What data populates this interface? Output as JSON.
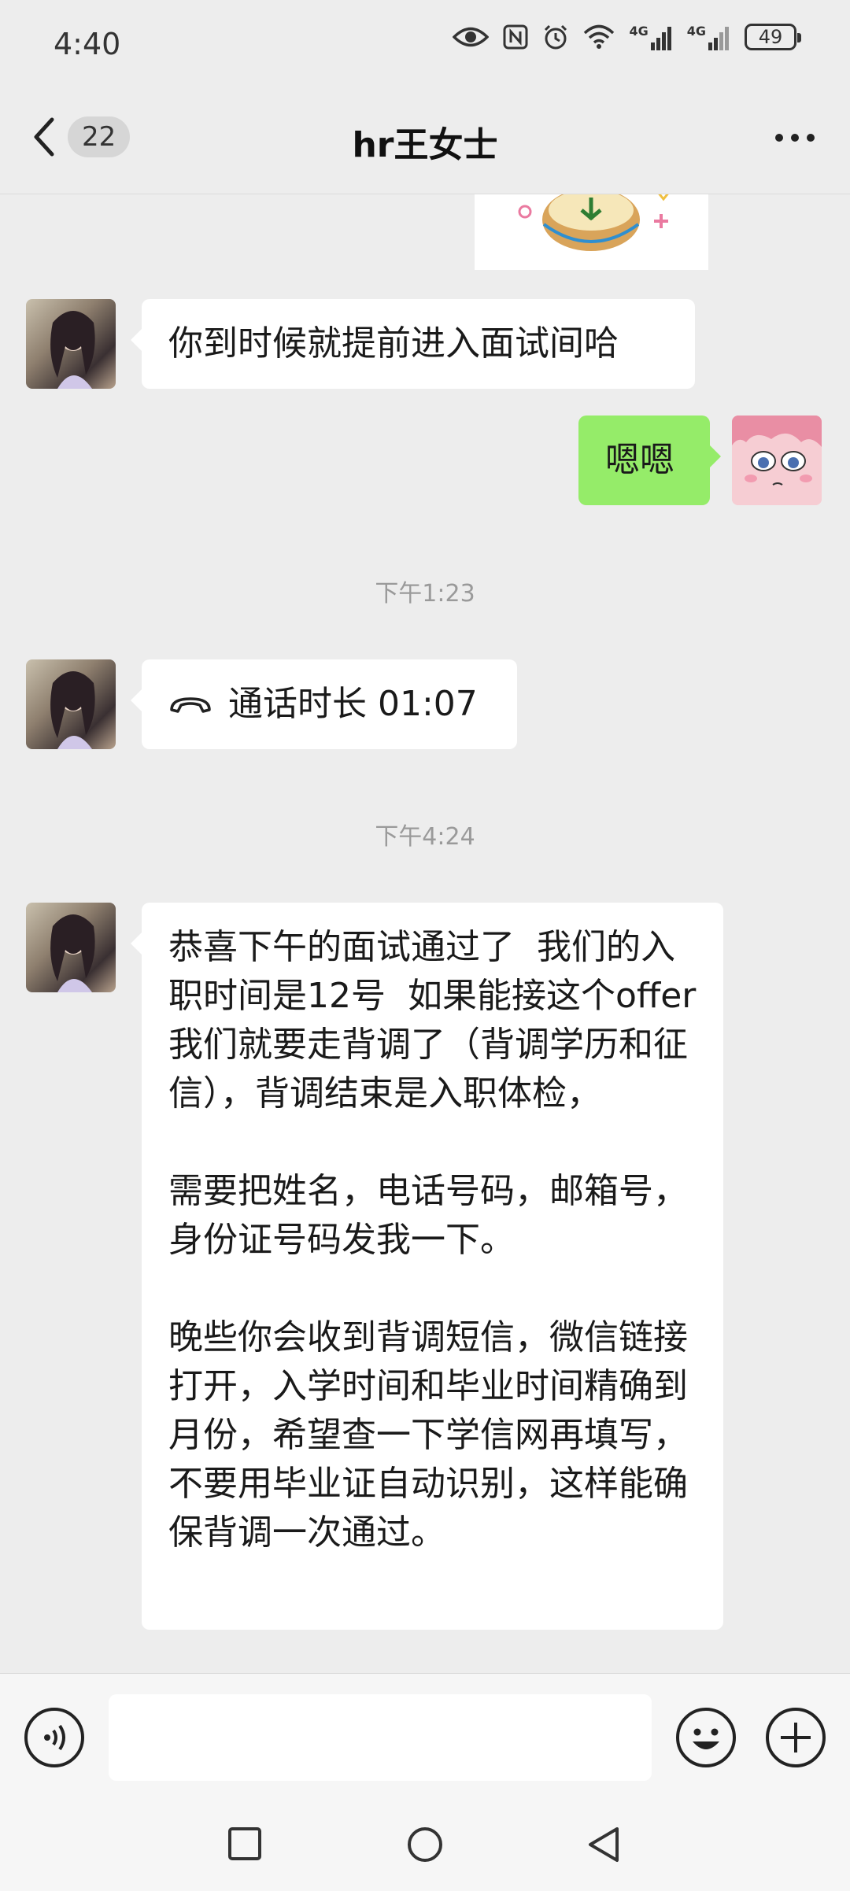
{
  "status_bar": {
    "time": "4:40",
    "signal_1": "4G",
    "signal_2": "4G",
    "battery": "49"
  },
  "nav": {
    "unread_count": "22",
    "title": "hr王女士"
  },
  "messages": {
    "m1": "你到时候就提前进入面试间哈",
    "m2": "嗯嗯",
    "ts1": "下午1:23",
    "call_label": "通话时长 01:07",
    "ts2": "下午4:24",
    "m4_p1": "恭喜下午的面试通过了  我们的入职时间是12号  如果能接这个offer  我们就要走背调了（背调学历和征信），背调结束是入职体检，",
    "m4_p2": "需要把姓名，电话号码，邮箱号，身份证号码发我一下。",
    "m4_p3": "晚些你会收到背调短信，微信链接打开，入学时间和毕业时间精确到月份，希望查一下学信网再填写，不要用毕业证自动识别，这样能确保背调一次通过。"
  },
  "input": {
    "placeholder": ""
  },
  "colors": {
    "background": "#ededed",
    "outgoing_bubble": "#95ec69",
    "incoming_bubble": "#ffffff",
    "timestamp": "#9a9a9a"
  },
  "icons": [
    "eye-icon",
    "nfc-icon",
    "alarm-icon",
    "wifi-icon",
    "signal-icon",
    "battery-icon",
    "back-chevron-icon",
    "more-icon",
    "phone-hangup-icon",
    "voice-icon",
    "emoji-icon",
    "plus-icon",
    "recents-icon",
    "home-icon",
    "back-triangle-icon"
  ]
}
